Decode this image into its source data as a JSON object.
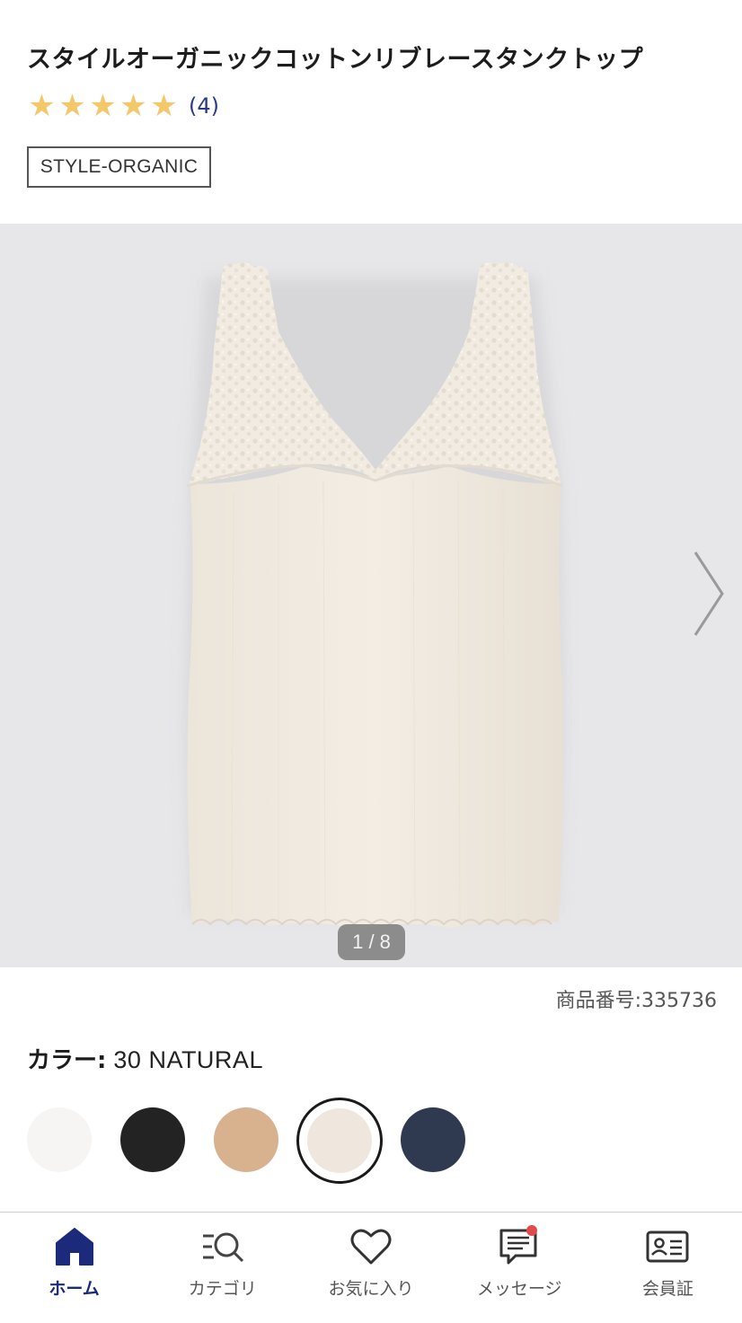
{
  "product": {
    "title": "スタイルオーガニックコットンリブレースタンクトップ",
    "rating_stars": 5,
    "review_count": "(4)",
    "tag": "STYLE-ORGANIC",
    "item_number": "商品番号:335736"
  },
  "gallery": {
    "counter": "1 / 8"
  },
  "color": {
    "label": "カラー:",
    "selected_value": "30 NATURAL",
    "swatches": [
      {
        "color": "#f6f5f4",
        "selected": false
      },
      {
        "color": "#232324",
        "selected": false
      },
      {
        "color": "#d8b28f",
        "selected": false
      },
      {
        "color": "#efe7dd",
        "selected": true
      },
      {
        "color": "#2f3a50",
        "selected": false
      }
    ]
  },
  "nav": {
    "items": [
      {
        "label": "ホーム",
        "icon": "home-icon",
        "active": true
      },
      {
        "label": "カテゴリ",
        "icon": "category-search-icon",
        "active": false
      },
      {
        "label": "お気に入り",
        "icon": "heart-icon",
        "active": false
      },
      {
        "label": "メッセージ",
        "icon": "message-icon",
        "active": false,
        "badge": true
      },
      {
        "label": "会員証",
        "icon": "member-card-icon",
        "active": false
      }
    ]
  },
  "colors": {
    "star": "#f2c86a",
    "review_link": "#2a3a86",
    "nav_active": "#1b2a7a",
    "badge": "#e24b4b"
  }
}
